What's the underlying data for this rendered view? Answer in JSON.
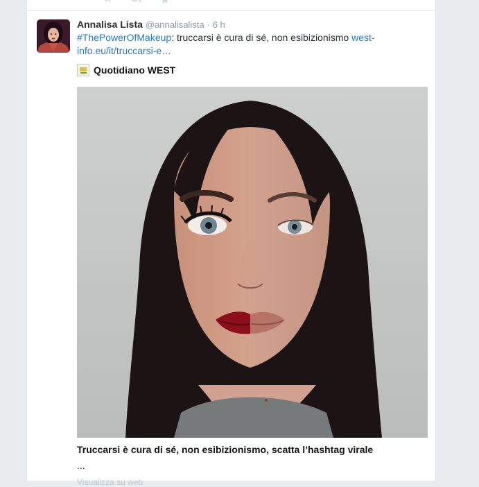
{
  "tweet": {
    "fullname": "Annalisa Lista",
    "screen_name": "@annalisalista",
    "dot": "·",
    "time": "6 h",
    "hashtag": "#ThePowerOfMakeup",
    "text": ": truccarsi è cura di sé, non esibizionismo ",
    "link": "west-info.eu/it/truccarsi-e…"
  },
  "card": {
    "source": "Quotidiano WEST",
    "title": "Truccarsi è cura di sé, non esibizionismo, scatta l’hashtag virale",
    "description": "...",
    "more": "Visualizza su web"
  },
  "colors": {
    "link": "#2b7bb9",
    "muted": "#8899a6",
    "text": "#292f33",
    "border": "#e1e8ed"
  },
  "icons": [
    "reply-icon",
    "retweet-icon",
    "favorite-icon",
    "source-logo-icon"
  ]
}
